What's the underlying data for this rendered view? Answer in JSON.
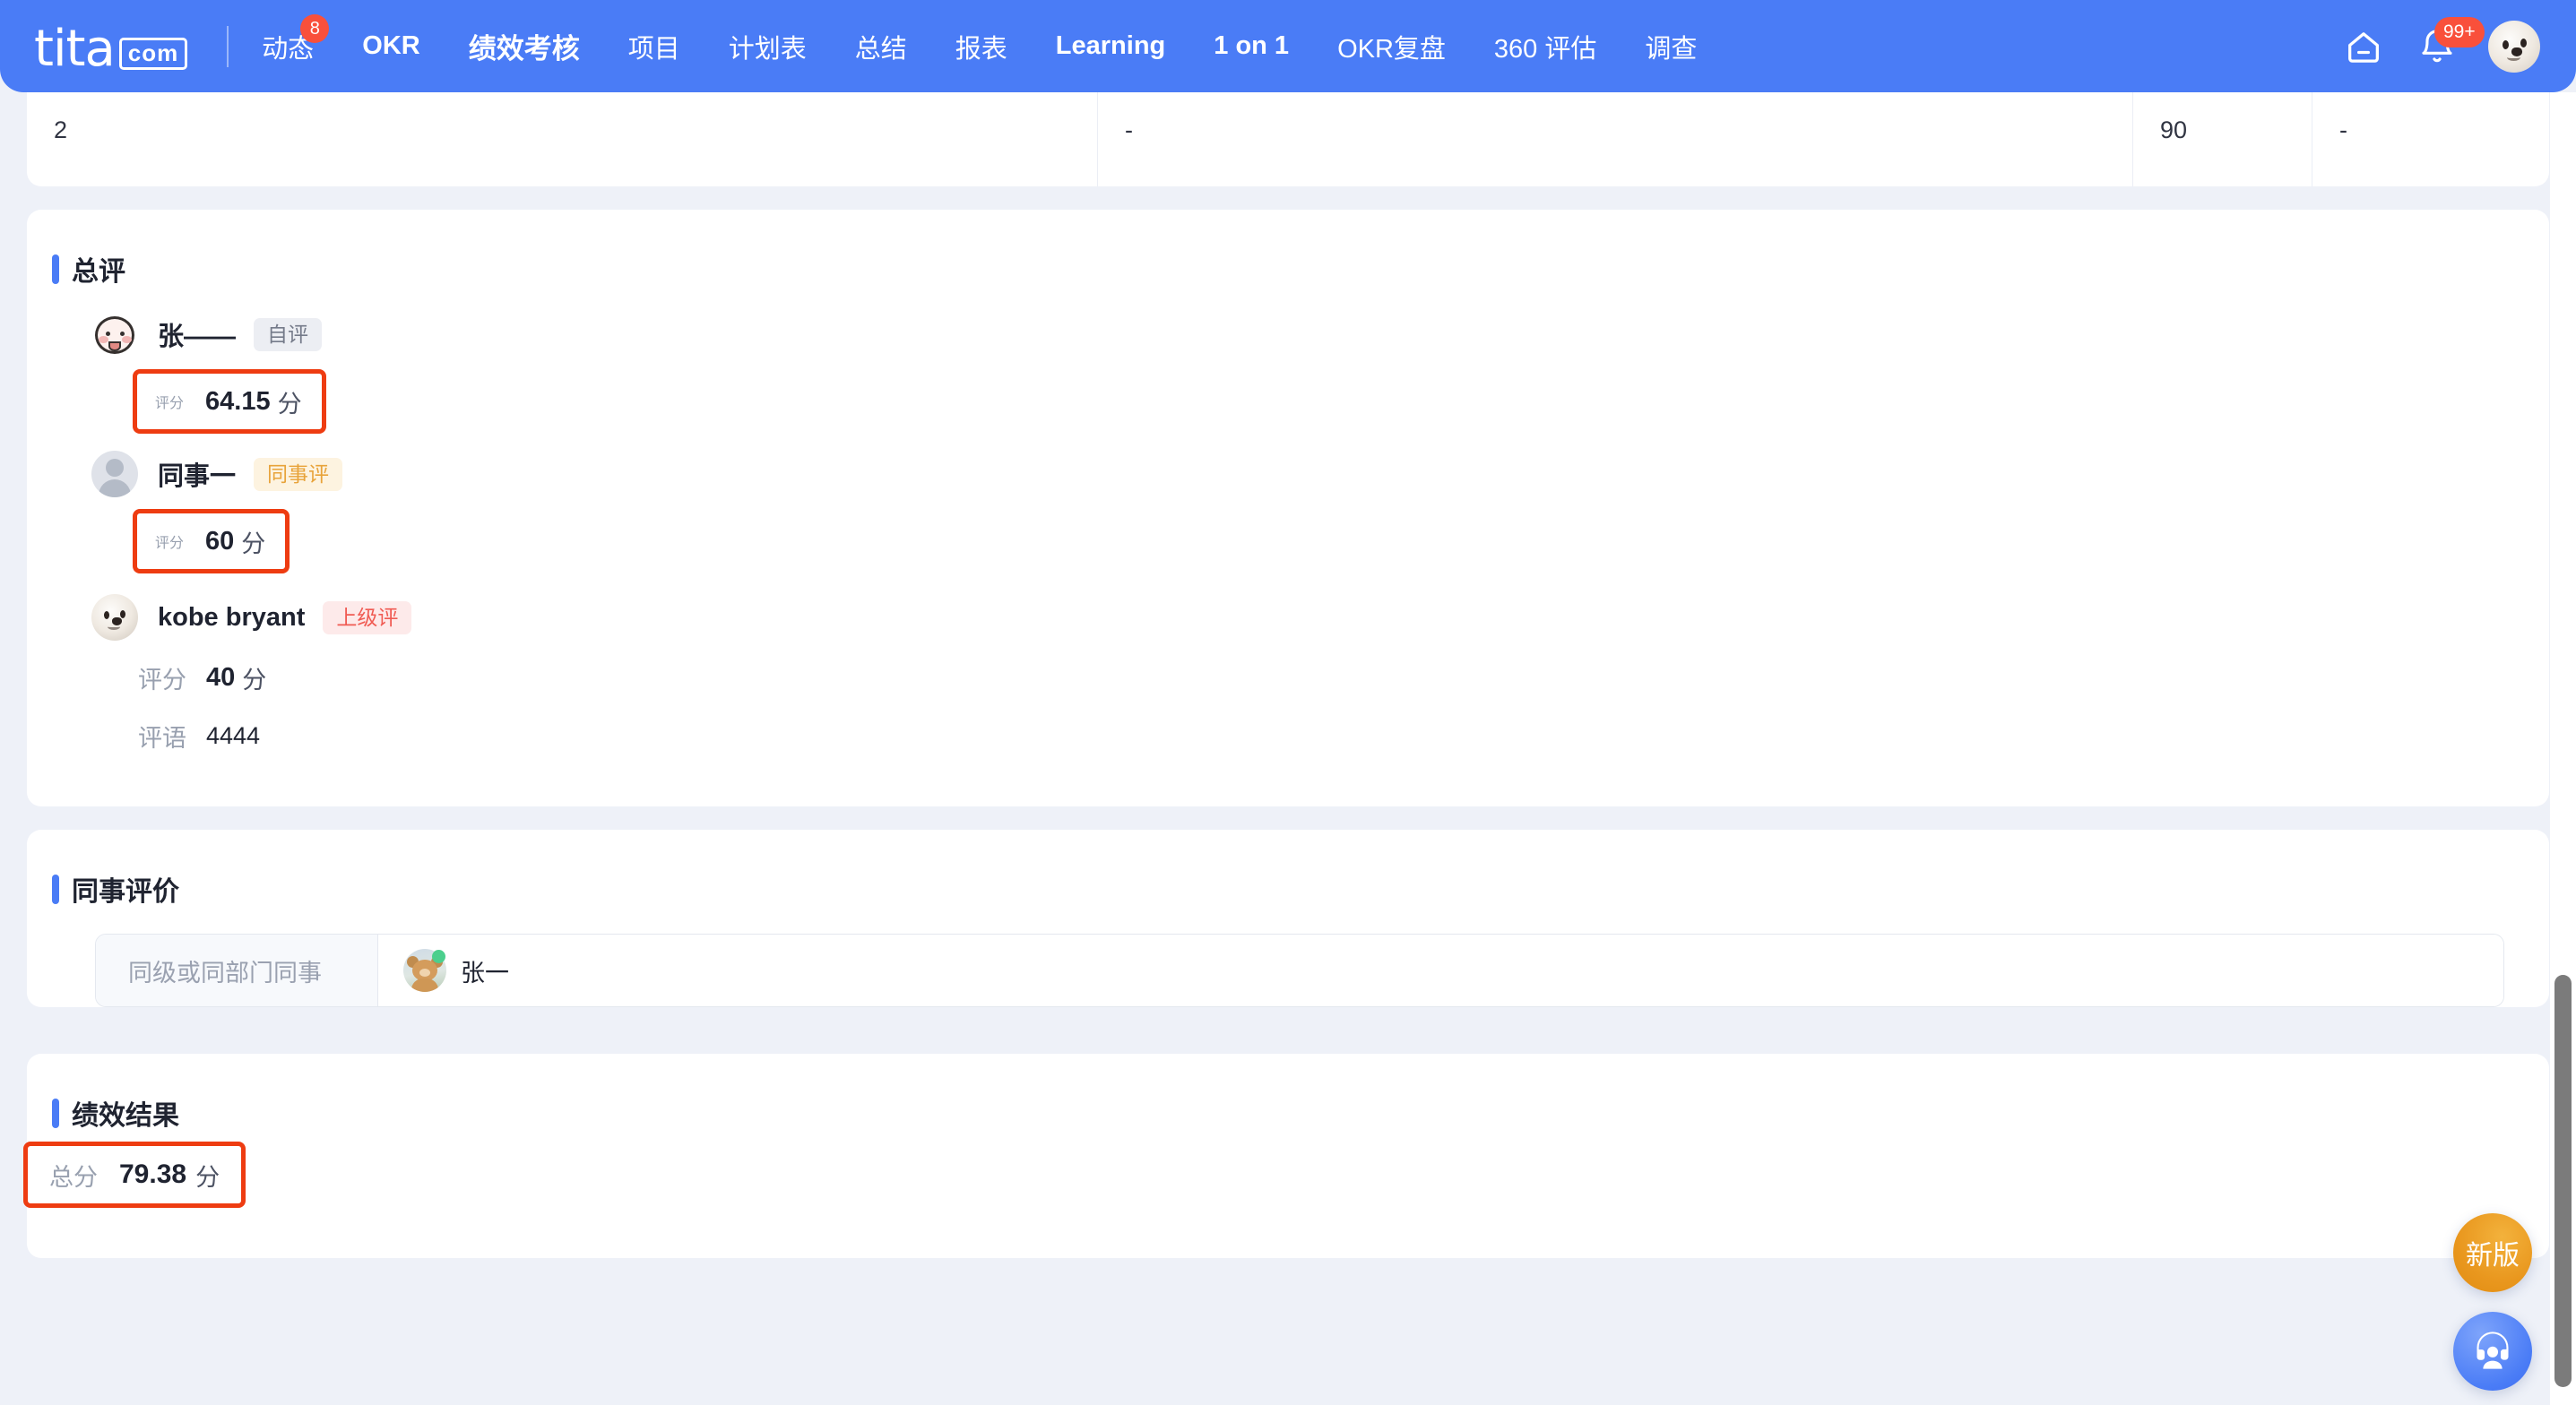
{
  "nav": {
    "logo_word": "tita",
    "logo_suffix": "com",
    "items": [
      {
        "label": "动态",
        "badge": "8",
        "active": false,
        "bold": false
      },
      {
        "label": "OKR",
        "badge": null,
        "active": false,
        "bold": true
      },
      {
        "label": "绩效考核",
        "badge": null,
        "active": true,
        "bold": true
      },
      {
        "label": "项目",
        "badge": null,
        "active": false,
        "bold": false
      },
      {
        "label": "计划表",
        "badge": null,
        "active": false,
        "bold": false
      },
      {
        "label": "总结",
        "badge": null,
        "active": false,
        "bold": false
      },
      {
        "label": "报表",
        "badge": null,
        "active": false,
        "bold": false
      },
      {
        "label": "Learning",
        "badge": null,
        "active": false,
        "bold": true
      },
      {
        "label": "1 on 1",
        "badge": null,
        "active": false,
        "bold": true
      },
      {
        "label": "OKR复盘",
        "badge": null,
        "active": false,
        "bold": false
      },
      {
        "label": "360 评估",
        "badge": null,
        "active": false,
        "bold": false
      },
      {
        "label": "调查",
        "badge": null,
        "active": false,
        "bold": false
      }
    ],
    "home_icon": "home-icon",
    "bell_icon": "bell-icon",
    "bell_badge": "99+",
    "avatar": "user-avatar"
  },
  "table": {
    "row": {
      "index": "2",
      "col2": "-",
      "col3": "90",
      "col4": "-"
    }
  },
  "overall_review": {
    "title": "总评",
    "reviewers": [
      {
        "name": "张——",
        "tag": "自评",
        "tag_type": "self",
        "avatar": "zhang-avatar",
        "score_label": "评分",
        "score_value": "64.15",
        "score_unit": "分",
        "highlighted": true,
        "comment_label": null,
        "comment_value": null
      },
      {
        "name": "同事一",
        "tag": "同事评",
        "tag_type": "peer",
        "avatar": "blank-avatar",
        "score_label": "评分",
        "score_value": "60",
        "score_unit": "分",
        "highlighted": true,
        "comment_label": null,
        "comment_value": null
      },
      {
        "name": "kobe bryant",
        "tag": "上级评",
        "tag_type": "supervisor",
        "avatar": "kobe-avatar",
        "score_label": "评分",
        "score_value": "40",
        "score_unit": "分",
        "highlighted": false,
        "comment_label": "评语",
        "comment_value": "4444"
      }
    ]
  },
  "peer_evaluation": {
    "title": "同事评价",
    "field_label": "同级或同部门同事",
    "selected_name": "张一",
    "selected_avatar": "bear-avatar",
    "online": true
  },
  "performance_result": {
    "title": "绩效结果",
    "total_label": "总分",
    "total_value": "79.38",
    "total_unit": "分"
  },
  "floating": {
    "new_version_label": "新版",
    "support_icon": "headset-support-icon"
  },
  "colors": {
    "brand_blue": "#4a7cf6",
    "highlight_red": "#ee3c11",
    "badge_red": "#f9503b",
    "accent_orange": "#e9971e",
    "page_bg": "#eef1f8"
  }
}
